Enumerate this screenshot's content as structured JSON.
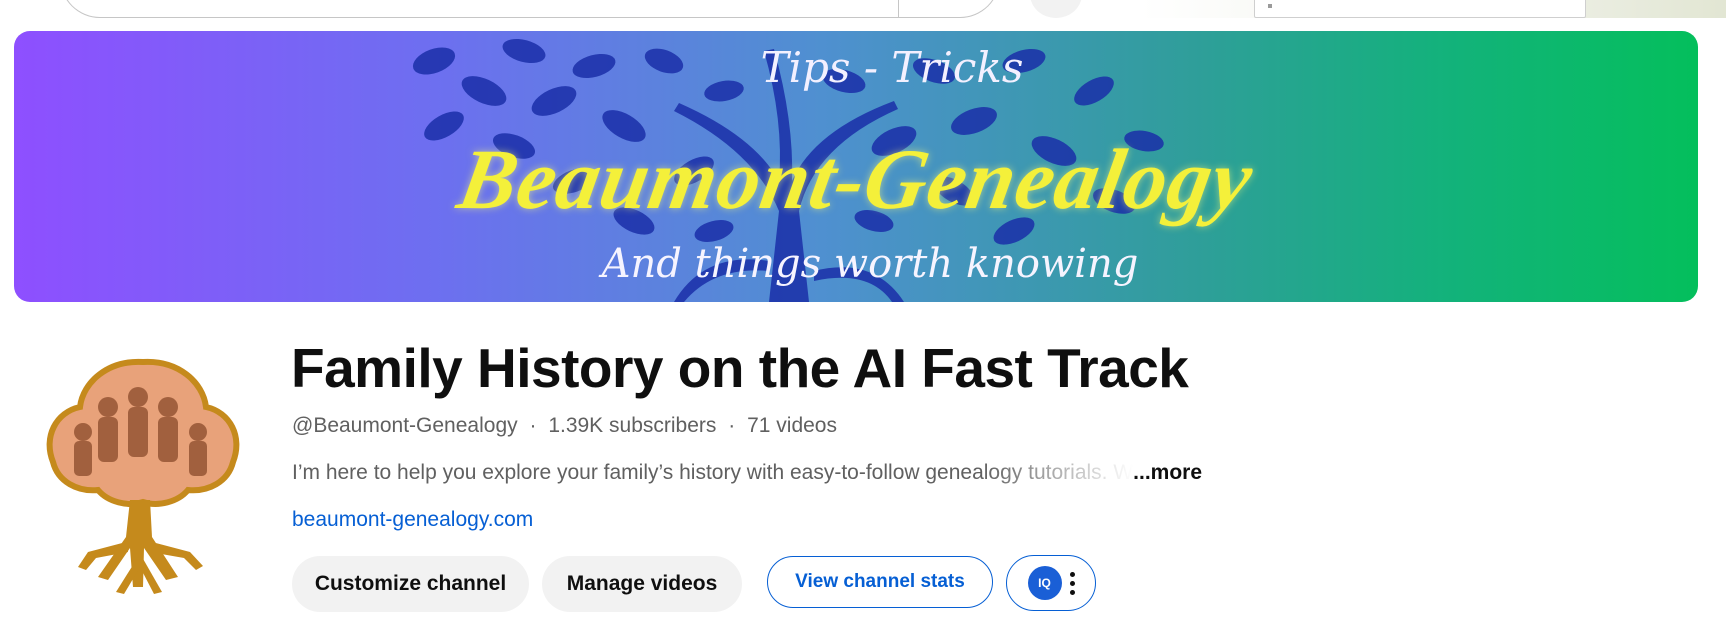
{
  "banner": {
    "top_text": "Tips - Tricks",
    "title": "Beaumont-Genealogy",
    "subtitle": "And things worth knowing"
  },
  "channel": {
    "name": "Family History on the AI Fast Track",
    "handle": "@Beaumont-Genealogy",
    "subscribers": "1.39K subscribers",
    "videos": "71 videos",
    "separator_1": "·",
    "separator_2": "·",
    "description": "I’m here to help you explore your family’s history with easy-to-follow genealogy tutorials. W",
    "more_label": "...more",
    "link": "beaumont-genealogy.com"
  },
  "actions": {
    "customize_label": "Customize channel",
    "manage_label": "Manage videos",
    "stats_label": "View channel stats",
    "extension_badge": "IQ"
  },
  "colors": {
    "link": "#065fd4",
    "banner_left": "#8e4fff",
    "banner_right": "#04bf5c",
    "banner_title": "#f4f03a"
  },
  "icons": {
    "avatar": "tree-family-portrait-logo",
    "extension": "vidiq-extension-icon",
    "more": "kebab-menu-icon"
  }
}
